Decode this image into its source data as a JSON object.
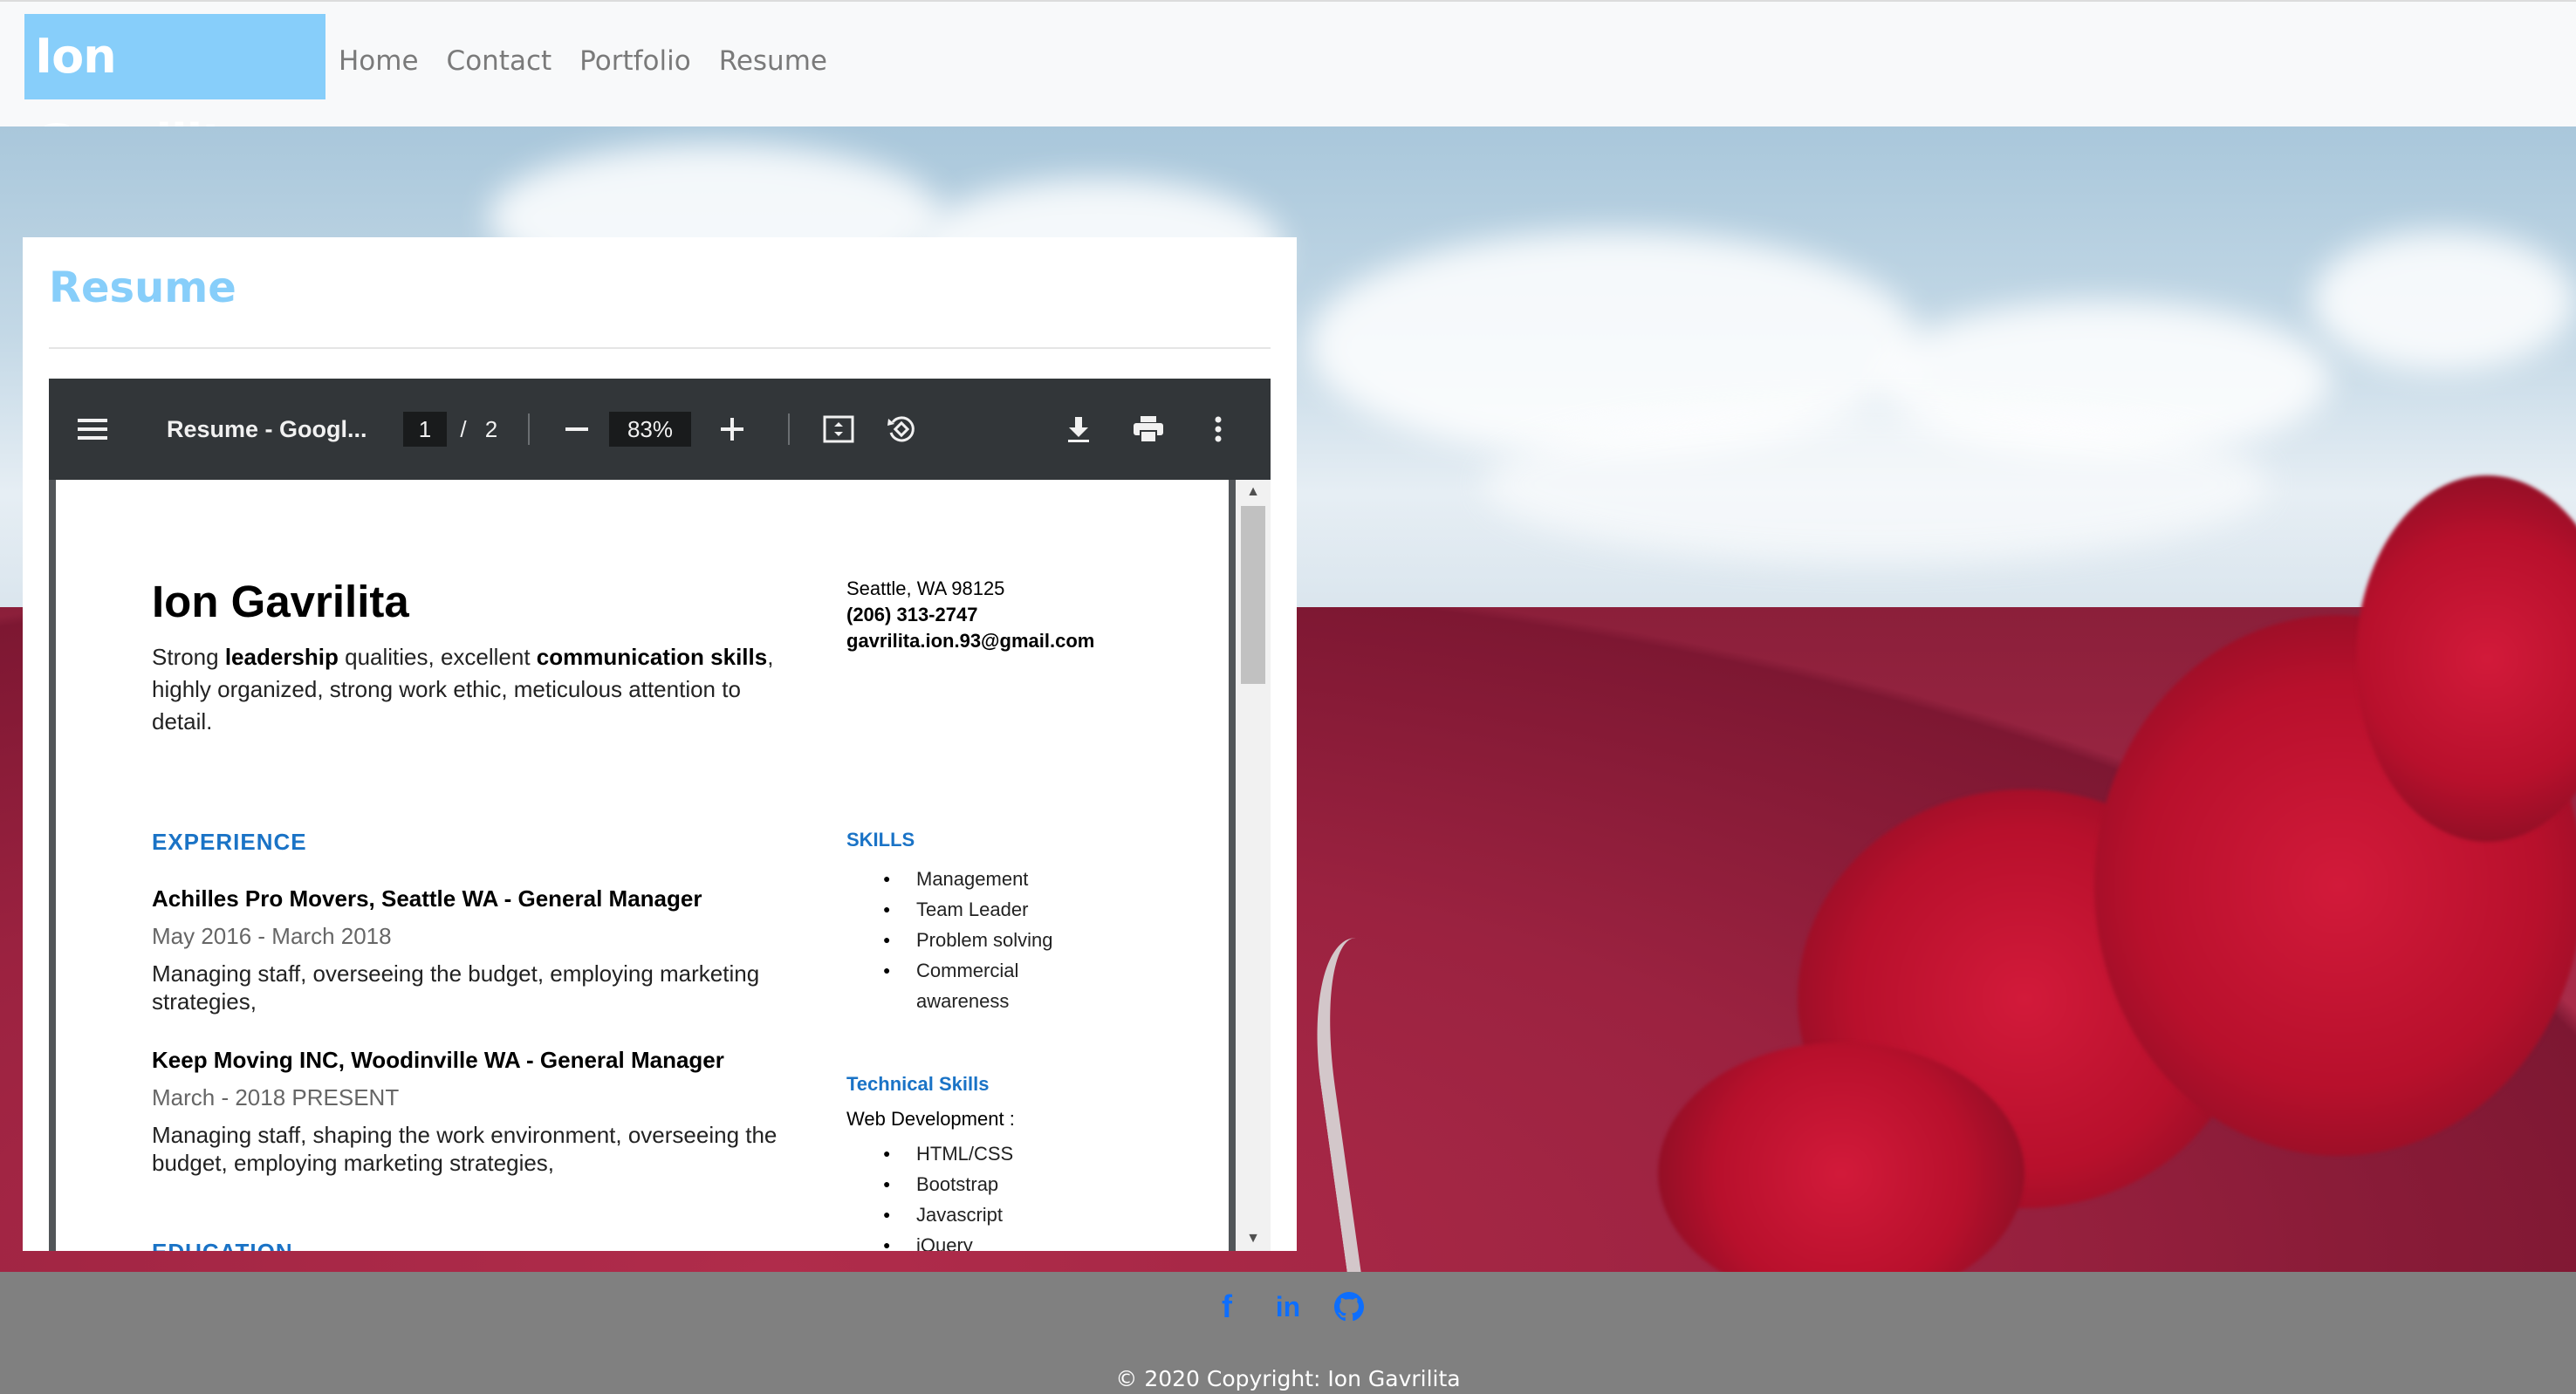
{
  "navbar": {
    "brand": "Ion Gavrilita",
    "links": [
      "Home",
      "Contact",
      "Portfolio",
      "Resume"
    ]
  },
  "card": {
    "title": "Resume"
  },
  "pdf_viewer": {
    "menu_icon": "hamburger-menu-icon",
    "doc_title": "Resume - Googl...",
    "current_page": "1",
    "page_separator": "/",
    "total_pages": "2",
    "zoom": "83%",
    "icons": [
      "minus-icon",
      "plus-icon",
      "fit-page-icon",
      "rotate-icon",
      "download-icon",
      "print-icon",
      "more-vert-icon"
    ]
  },
  "resume": {
    "name": "Ion Gavrilita",
    "summary_parts": [
      "Strong ",
      "leadership",
      " qualities, excellent ",
      "communication skills",
      ", highly organized, strong work ethic, meticulous attention to detail."
    ],
    "contact": {
      "address": "Seattle, WA 98125",
      "phone": "(206) 313-2747",
      "email": "gavrilita.ion.93@gmail.com"
    },
    "experience_heading": "EXPERIENCE",
    "jobs": [
      {
        "title": "Achilles Pro Movers, Seattle WA - General Manager",
        "dates": "May 2016 - March 2018",
        "description": "Managing staff, overseeing the budget, employing marketing strategies,"
      },
      {
        "title": "Keep Moving INC, Woodinville WA - General Manager",
        "dates": "March - 2018 PRESENT",
        "description": "Managing staff, shaping the work environment,  overseeing the budget, employing marketing strategies,"
      }
    ],
    "education_heading": "EDUCATION",
    "skills_heading": "SKILLS",
    "skills": [
      "Management",
      "Team Leader",
      "Problem solving",
      "Commercial",
      "awareness"
    ],
    "tech_heading": "Technical Skills",
    "tech_sub": "Web Development :",
    "tech_skills": [
      "HTML/CSS",
      "Bootstrap",
      "Javascript",
      "jQuery"
    ]
  },
  "footer": {
    "social_icons": [
      "facebook-icon",
      "linkedin-icon",
      "github-icon"
    ],
    "facebook_glyph": "f",
    "linkedin_glyph": "in",
    "copyright": "© 2020 Copyright: Ion Gavrilita"
  },
  "colors": {
    "brand_bg": "#87cefa",
    "heading": "#87cefa",
    "footer_bg": "#808080",
    "social": "#0d6efd",
    "resume_accent": "#1a73c6"
  }
}
